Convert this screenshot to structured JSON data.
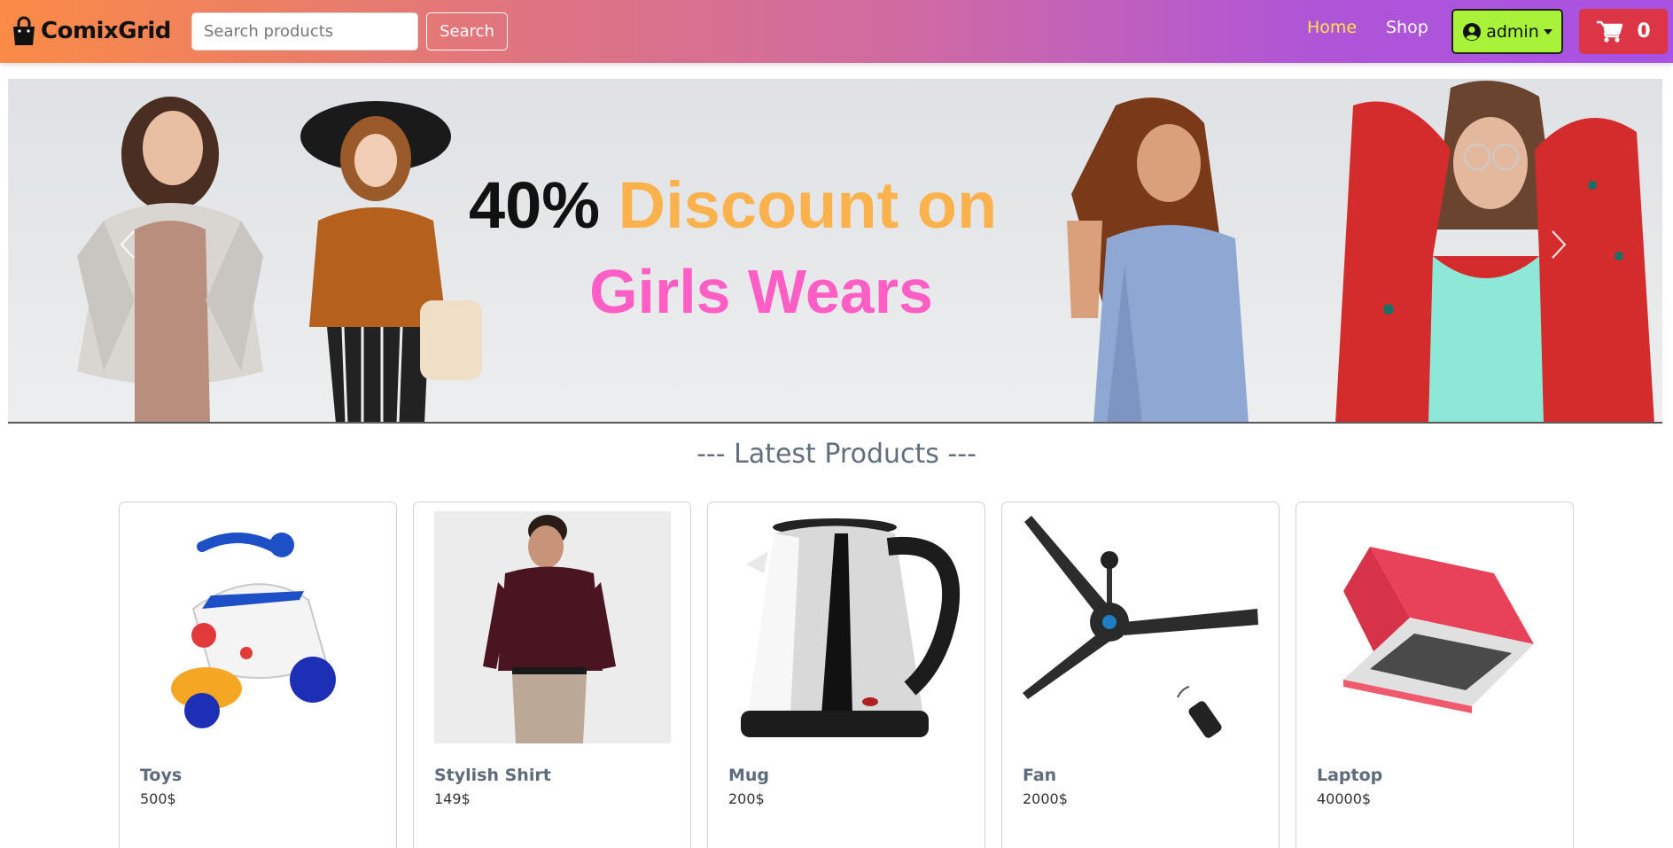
{
  "brand": {
    "name": "ComixGrid",
    "icon": "shopping-bag-icon"
  },
  "search": {
    "placeholder": "Search products",
    "value": "",
    "button_label": "Search"
  },
  "nav": {
    "links": [
      {
        "label": "Home",
        "active": true
      },
      {
        "label": "Shop",
        "active": false
      }
    ],
    "user": {
      "label": "admin",
      "icon": "user-circle-icon",
      "caret": "caret-down-icon"
    },
    "cart": {
      "count": "0",
      "icon": "cart-icon"
    }
  },
  "banner": {
    "line1_pct": "40%",
    "line1_rest": "Discount on",
    "line2": "Girls Wears",
    "prev_icon": "chevron-left-icon",
    "next_icon": "chevron-right-icon"
  },
  "section": {
    "title": "--- Latest Products ---"
  },
  "products": [
    {
      "name": "Toys",
      "price": "500$",
      "image": "toy-scooter"
    },
    {
      "name": "Stylish Shirt",
      "price": "149$",
      "image": "man-in-shirt"
    },
    {
      "name": "Mug",
      "price": "200$",
      "image": "electric-kettle"
    },
    {
      "name": "Fan",
      "price": "2000$",
      "image": "ceiling-fan"
    },
    {
      "name": "Laptop",
      "price": "40000$",
      "image": "red-laptop"
    }
  ],
  "colors": {
    "nav_gradient_start": "#fb8b46",
    "nav_gradient_end": "#a752e4",
    "home_active": "#ffe24a",
    "admin_bg": "#a8f23a",
    "cart_bg": "#dc3545",
    "banner_accent": "#fcb24c",
    "banner_pink": "#ff5fc4",
    "title_gray": "#616e7d"
  }
}
